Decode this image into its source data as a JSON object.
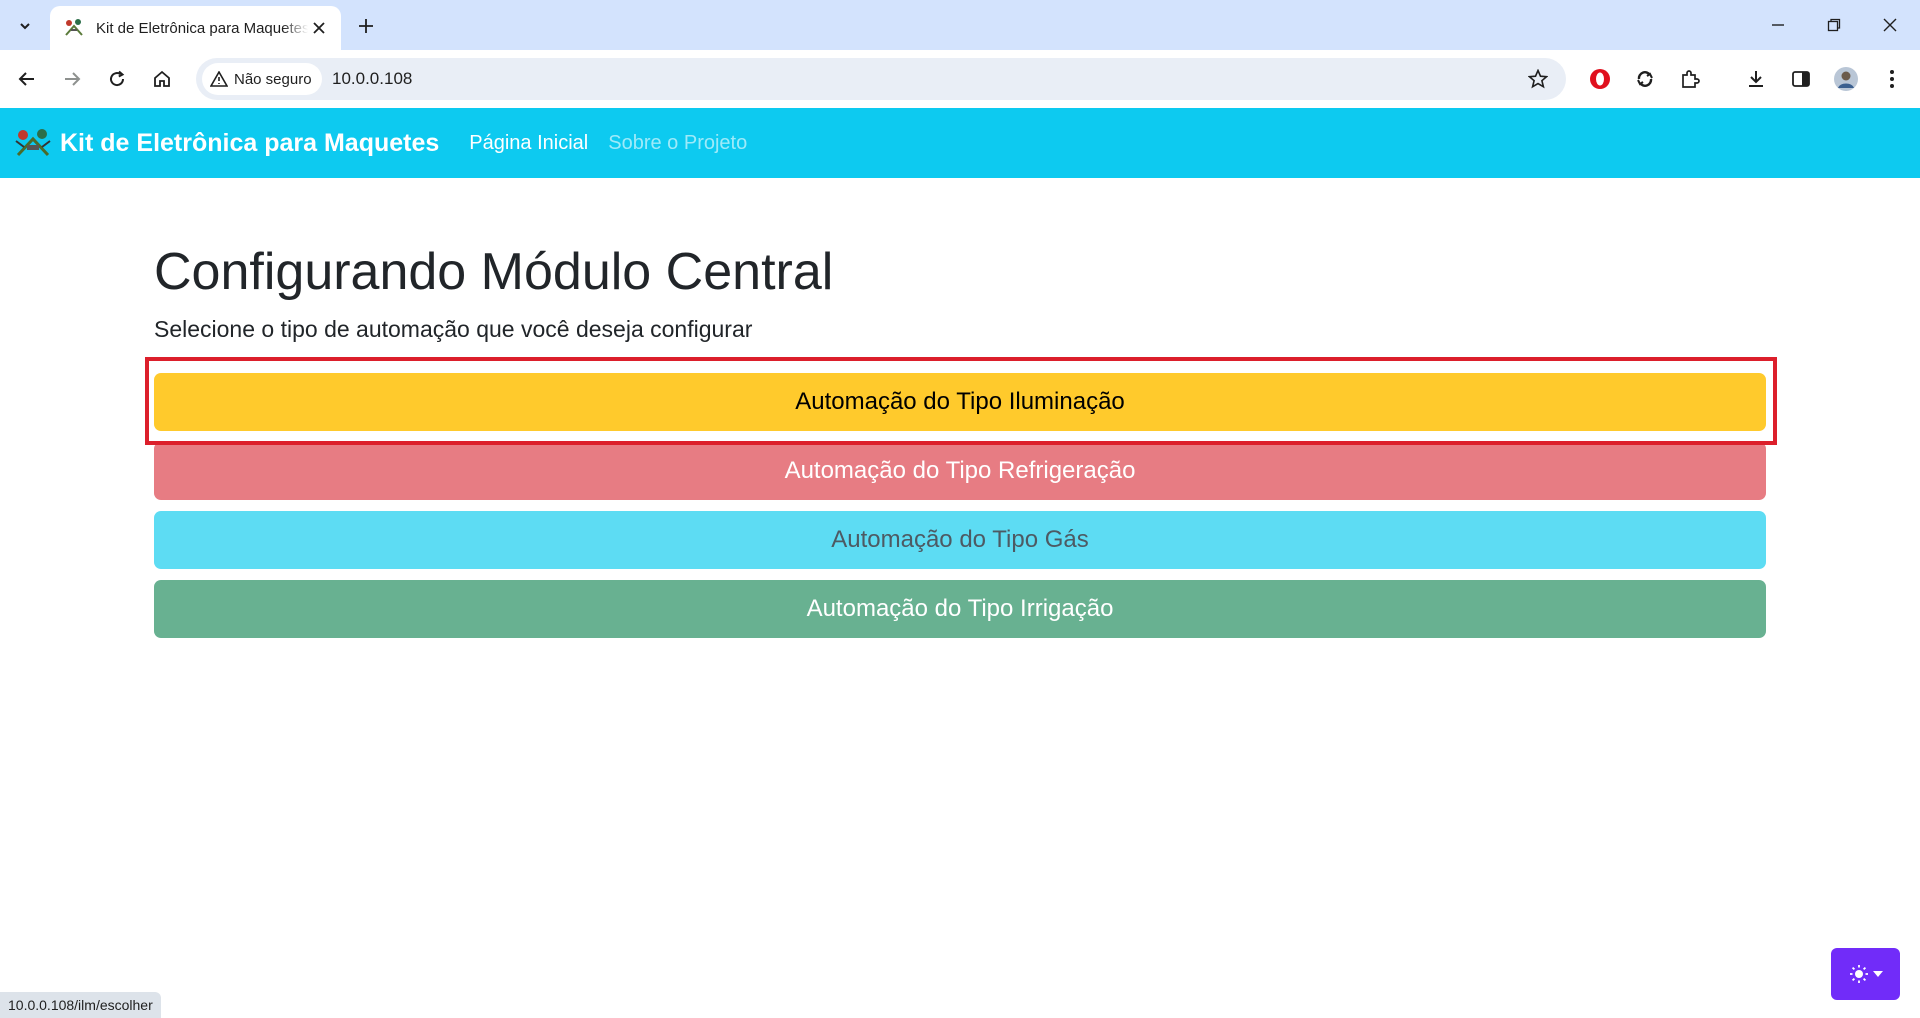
{
  "browser": {
    "tab_title": "Kit de Eletrônica para Maquetes",
    "security_label": "Não seguro",
    "url": "10.0.0.108",
    "status_url": "10.0.0.108/ilm/escolher",
    "colors": {
      "tabstrip": "#d3e3fd",
      "omnibox": "#e9eef6"
    },
    "icons": [
      "tab-search-icon",
      "close-icon",
      "plus-icon",
      "minimize-icon",
      "restore-icon",
      "back-arrow-icon",
      "forward-arrow-icon",
      "reload-icon",
      "home-icon",
      "warning-triangle-icon",
      "star-icon",
      "opera-icon",
      "sync-icon",
      "puzzle-icon",
      "download-icon",
      "sidebar-icon",
      "avatar-icon",
      "kebab-menu-icon"
    ]
  },
  "navbar": {
    "brand": "Kit de Eletrônica para Maquetes",
    "links": [
      "Página Inicial",
      "Sobre o Projeto"
    ],
    "color": "#0dcaf0"
  },
  "main": {
    "title": "Configurando Módulo Central",
    "lead": "Selecione o tipo de automação que você deseja configurar",
    "buttons": [
      {
        "label": "Automação do Tipo Iluminação",
        "color": "#ffca2c"
      },
      {
        "label": "Automação do Tipo Refrigeração",
        "color": "#e77c83"
      },
      {
        "label": "Automação do Tipo Gás",
        "color": "#5ddcf3"
      },
      {
        "label": "Automação do Tipo Irrigação",
        "color": "#68b191"
      }
    ]
  },
  "annotation": {
    "highlight_color": "#dc1f2b"
  },
  "theme_toggle": {
    "icon": "sun-icon",
    "color": "#712cf9"
  }
}
